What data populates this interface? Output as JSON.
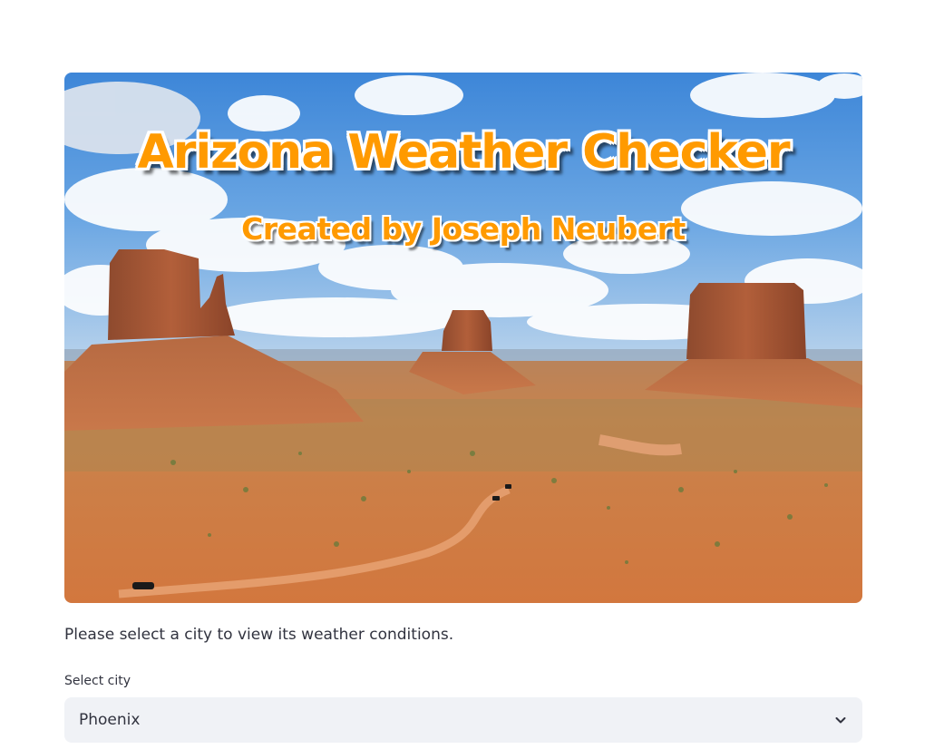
{
  "hero": {
    "title": "Arizona Weather Checker",
    "subtitle": "Created by Joseph Neubert",
    "image_subject": "monument-valley-landscape"
  },
  "intro_text": "Please select a city to view its weather conditions.",
  "city_select": {
    "label": "Select city",
    "selected": "Phoenix",
    "icon": "chevron-down-icon"
  },
  "colors": {
    "title_orange": "#ff9a00",
    "select_background": "#f0f2f6",
    "text": "#31333f"
  }
}
